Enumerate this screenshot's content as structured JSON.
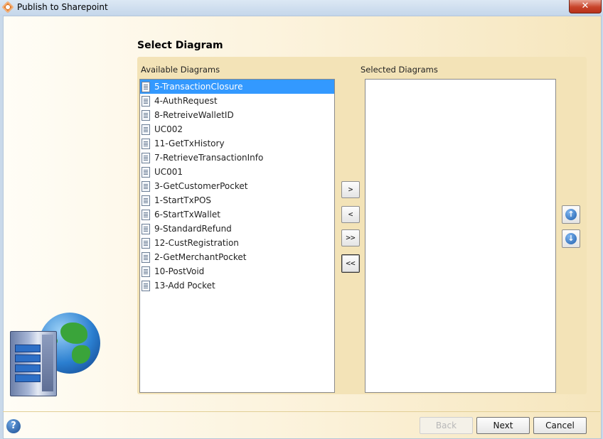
{
  "window": {
    "title": "Publish to Sharepoint",
    "close_glyph": "✕"
  },
  "header": {
    "title": "Select Diagram"
  },
  "available": {
    "label": "Available Diagrams",
    "items": [
      "5-TransactionClosure",
      "4-AuthRequest",
      "8-RetreiveWalletID",
      "UC002",
      "11-GetTxHistory",
      "7-RetrieveTransactionInfo",
      "UC001",
      "3-GetCustomerPocket",
      "1-StartTxPOS",
      "6-StartTxWallet",
      "9-StandardRefund",
      "12-CustRegistration",
      "2-GetMerchantPocket",
      "10-PostVoid",
      "13-Add Pocket"
    ],
    "selected_index": 0
  },
  "selected": {
    "label": "Selected Diagrams",
    "items": []
  },
  "transfer_buttons": {
    "add": ">",
    "remove": "<",
    "add_all": ">>",
    "remove_all": "<<"
  },
  "order_buttons": {
    "up": "↑",
    "down": "↓"
  },
  "footer": {
    "help": "?",
    "back": "Back",
    "next": "Next",
    "cancel": "Cancel"
  },
  "icons": {
    "document": "document-icon",
    "help": "help-icon",
    "up": "arrow-up-icon",
    "down": "arrow-down-icon"
  }
}
